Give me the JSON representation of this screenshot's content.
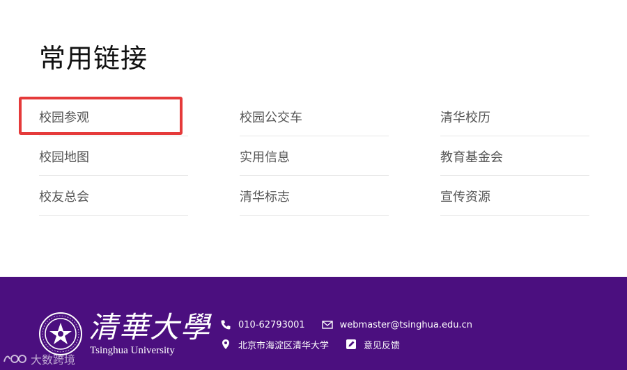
{
  "links_section": {
    "title": "常用链接",
    "items": [
      {
        "label": "校园参观"
      },
      {
        "label": "校园公交车"
      },
      {
        "label": "清华校历"
      },
      {
        "label": "校园地图"
      },
      {
        "label": "实用信息"
      },
      {
        "label": "教育基金会"
      },
      {
        "label": "校友总会"
      },
      {
        "label": "清华标志"
      },
      {
        "label": "宣传资源"
      }
    ]
  },
  "footer": {
    "logo_cn": "清華大學",
    "logo_en": "Tsinghua University",
    "phone": "010-62793001",
    "email": "webmaster@tsinghua.edu.cn",
    "address": "北京市海淀区清华大学",
    "feedback": "意见反馈",
    "bg_color": "#4b0f7f"
  },
  "watermark": {
    "text": "大数跨境"
  },
  "icons": {
    "phone": "phone-icon",
    "email": "mail-icon",
    "address": "location-pin-icon",
    "feedback": "edit-icon"
  },
  "highlight_color": "#e53a3a"
}
